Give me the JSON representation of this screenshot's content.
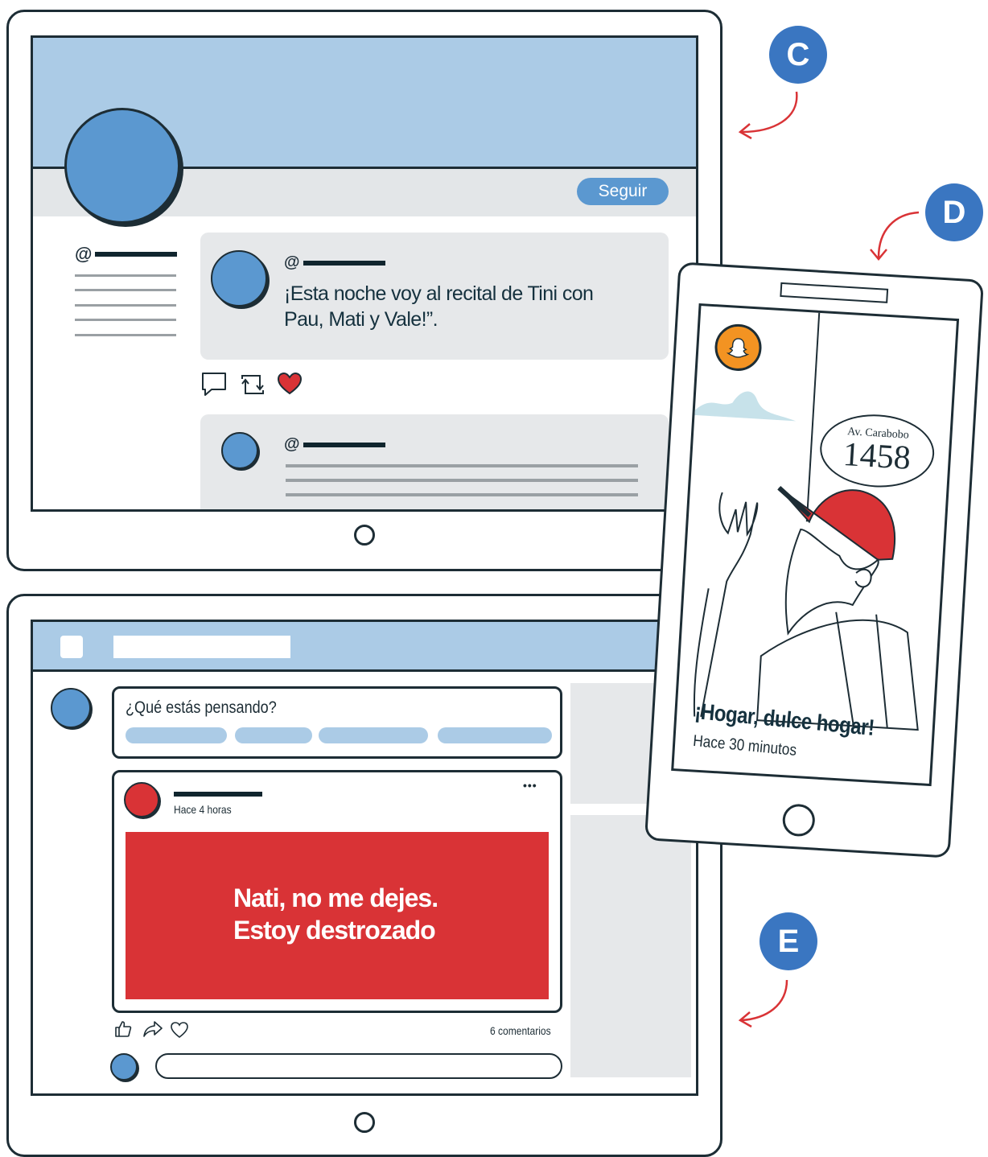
{
  "labels": {
    "c": "C",
    "d": "D",
    "e": "E"
  },
  "profile": {
    "follow_label": "Seguir",
    "handle_prefix": "@",
    "tweet_handle_prefix": "@",
    "tweet_text": "¡Esta noche voy al recital de Tini con Pau, Mati y Vale!”.",
    "second_handle_prefix": "@"
  },
  "feed": {
    "composer_placeholder": "¿Qué estás pensando?",
    "post_time": "Hace 4 horas",
    "post_image_text_line1": "Nati, no me dejes.",
    "post_image_text_line2": "Estoy destrozado",
    "comments": "6 comentarios",
    "more_label": "•••"
  },
  "story": {
    "sign_street": "Av. Carabobo",
    "sign_number": "1458",
    "caption": "¡Hogar, dulce hogar!",
    "time": "Hace 30 minutos"
  },
  "colors": {
    "accent_blue": "#5b98d0",
    "light_blue": "#abcbe6",
    "badge_blue": "#3a76c1",
    "red": "#d93336",
    "snapchat_orange": "#f39322",
    "outline": "#1d2d35",
    "gray_panel": "#e6e8ea"
  },
  "icons": [
    "comment-icon",
    "retweet-icon",
    "heart-icon",
    "like-icon",
    "share-icon",
    "ghost-icon",
    "arrow-icon"
  ]
}
